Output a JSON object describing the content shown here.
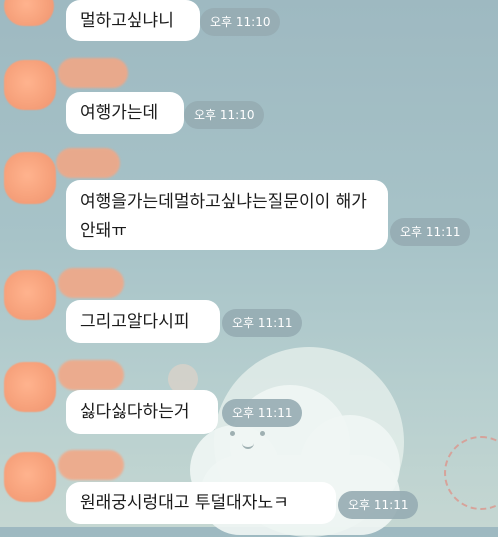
{
  "messages": [
    {
      "text": "멀하고싶냐니",
      "time": "오후 11:10"
    },
    {
      "text": "여행가는데",
      "time": "오후 11:10"
    },
    {
      "text": "여행을가는데멀하고싶냐는질문이이 해가안돼ㅠ",
      "time": "오후 11:11"
    },
    {
      "text": "그리고알다시피",
      "time": "오후 11:11"
    },
    {
      "text": "싫다싫다하는거",
      "time": "오후 11:11"
    },
    {
      "text": "원래궁시렁대고 투덜대자노ㅋ",
      "time": "오후 11:11"
    }
  ],
  "colors": {
    "background": "#a7c3c8",
    "bubble": "#ffffff",
    "timestamp_bg": "#96acb2",
    "avatar": "#f7a27c"
  }
}
